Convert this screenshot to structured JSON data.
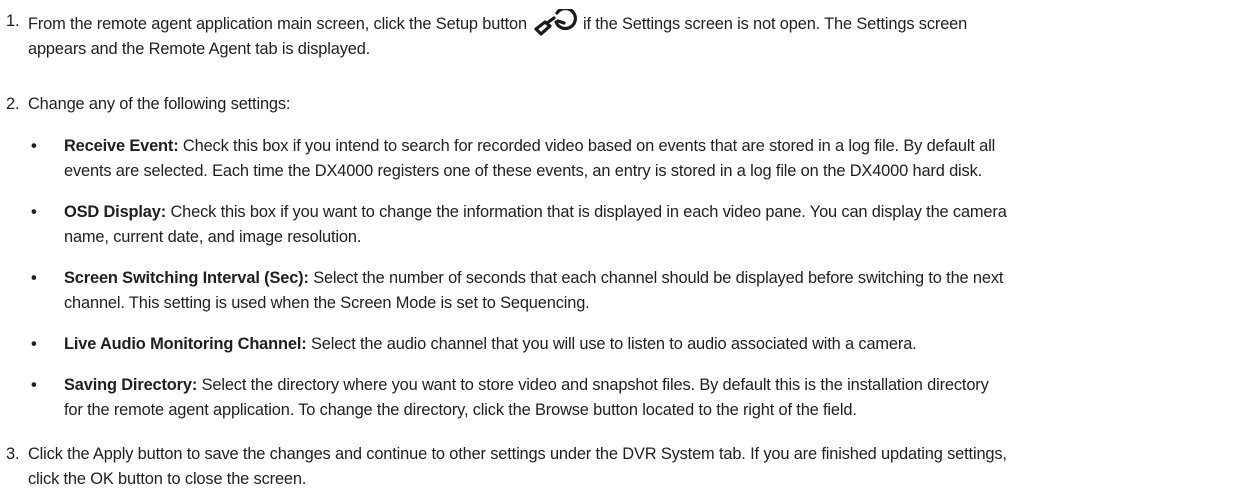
{
  "steps": [
    {
      "number": "1.",
      "text_before_icon": "From the remote agent application main screen, click the Setup button",
      "icon": "setup-wrench-icon",
      "text_after_icon": "if the Settings screen is not open. The Settings screen",
      "text_line2": "appears and the Remote Agent tab is displayed."
    },
    {
      "number": "2.",
      "text": "Change any of the following settings:"
    },
    {
      "number": "3.",
      "text_line1": "Click the Apply button to save the changes and continue to other settings under the DVR System tab. If you are finished updating settings,",
      "text_line2": "click the OK button to close the screen."
    }
  ],
  "bullet_symbol": "•",
  "bullets": [
    {
      "term": "Receive Event:",
      "line1": "Check this box if you intend to search for recorded video based on events that are stored in a log file. By default all",
      "line2": "events are selected. Each time the DX4000 registers one of these events, an entry is stored in a log file on the DX4000 hard disk."
    },
    {
      "term": "OSD Display:",
      "line1": "Check this box if you want to change the information that is displayed in each video pane. You can display the camera",
      "line2": "name, current date, and image resolution."
    },
    {
      "term": "Screen Switching Interval (Sec):",
      "line1": "Select the number of seconds that each channel should be displayed before switching to the next",
      "line2": "channel. This setting is used when the Screen Mode is set to Sequencing."
    },
    {
      "term": "Live Audio Monitoring Channel:",
      "line1": "Select the audio channel that you will use to listen to audio associated with a camera.",
      "line2": ""
    },
    {
      "term": "Saving Directory:",
      "line1": "Select the directory where you want to store video and snapshot files. By default this is the installation directory",
      "line2": "for the remote agent application. To change the directory, click the Browse button located to the right of the field."
    }
  ]
}
